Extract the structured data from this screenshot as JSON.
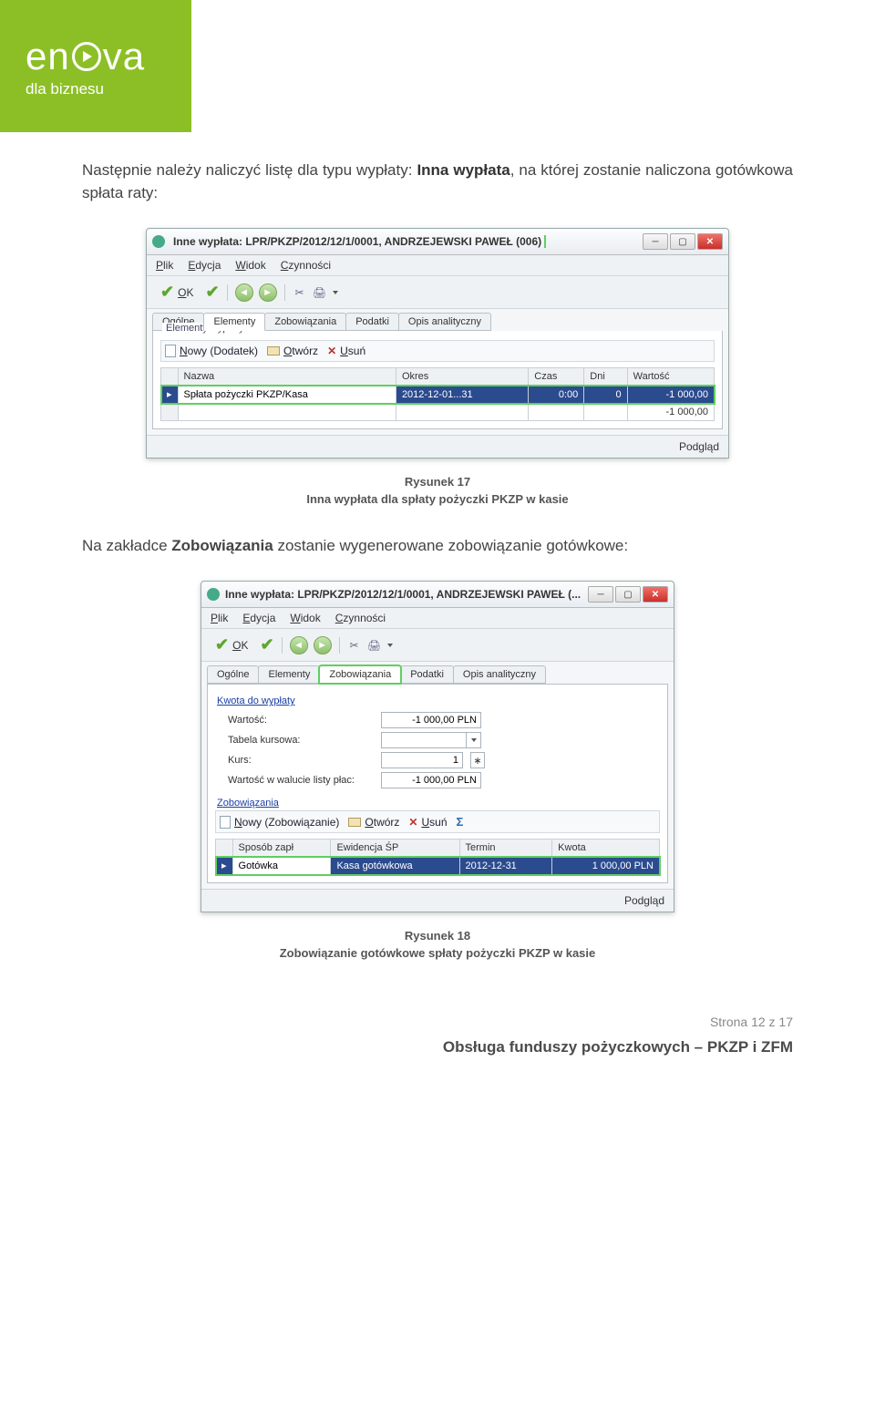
{
  "logo": {
    "brand_pre": "en",
    "brand_post": "va",
    "sub": "dla biznesu"
  },
  "para1_pre": "Następnie należy naliczyć listę dla typu wypłaty: ",
  "para1_bold": "Inna wypłata",
  "para1_post": ", na której zostanie naliczona gotówkowa spłata raty:",
  "win1": {
    "title": "Inne wypłata: LPR/PKZP/2012/12/1/0001, ANDRZEJEWSKI PAWEŁ (006)",
    "menu": {
      "plik_u": "P",
      "plik": "lik",
      "ed_u": "E",
      "ed": "dycja",
      "wid_u": "W",
      "wid": "idok",
      "czyn_u": "C",
      "czyn": "zynności"
    },
    "ok_u": "O",
    "ok": "K",
    "tabs": [
      "Ogólne",
      "Elementy",
      "Zobowiązania",
      "Podatki",
      "Opis analityczny"
    ],
    "legend": "Elementy wypłaty",
    "tb": {
      "nowy_u": "N",
      "nowy": "owy (Dodatek)",
      "otw_u": "O",
      "otw": "twórz",
      "usun_u": "U",
      "usun": "suń"
    },
    "cols": [
      "Nazwa",
      "Okres",
      "Czas",
      "Dni",
      "Wartość"
    ],
    "row": {
      "nazwa": "Spłata pożyczki PKZP/Kasa",
      "okres": "2012-12-01...31",
      "czas": "0:00",
      "dni": "0",
      "wart": "-1 000,00"
    },
    "sum": "-1 000,00",
    "status": "Podgląd"
  },
  "cap1_a": "Rysunek 17",
  "cap1_b": "Inna wypłata dla spłaty pożyczki PKZP w kasie",
  "para2_pre": "Na zakładce ",
  "para2_bold": "Zobowiązania",
  "para2_post": " zostanie wygenerowane zobowiązanie gotówkowe:",
  "win2": {
    "title": "Inne wypłata: LPR/PKZP/2012/12/1/0001, ANDRZEJEWSKI PAWEŁ (...",
    "menu": {
      "plik_u": "P",
      "plik": "lik",
      "ed_u": "E",
      "ed": "dycja",
      "wid_u": "W",
      "wid": "idok",
      "czyn_u": "C",
      "czyn": "zynności"
    },
    "ok_u": "O",
    "ok": "K",
    "tabs": [
      "Ogólne",
      "Elementy",
      "Zobowiązania",
      "Podatki",
      "Opis analityczny"
    ],
    "section1_u": "K",
    "section1": "wota do wypłaty",
    "rows": {
      "wartosc_l": "Wartość:",
      "wartosc_v": "-1 000,00 PLN",
      "tabela_l": "Tabela kursowa:",
      "tabela_v": "",
      "kurs_l": "Kurs:",
      "kurs_v": "1",
      "wwlp_l": "Wartość w walucie listy płac:",
      "wwlp_v": "-1 000,00 PLN"
    },
    "section2_u": "Z",
    "section2": "obowiązania",
    "tb": {
      "nowy_u": "N",
      "nowy": "owy (Zobowiązanie)",
      "otw_u": "O",
      "otw": "twórz",
      "usun_u": "U",
      "usun": "suń"
    },
    "cols": [
      "Sposób zapł",
      "Ewidencja ŚP",
      "Termin",
      "Kwota"
    ],
    "row": {
      "sposob": "Gotówka",
      "ewid": "Kasa gotówkowa",
      "termin": "2012-12-31",
      "kwota": "1 000,00 PLN"
    },
    "status": "Podgląd"
  },
  "cap2_a": "Rysunek 18",
  "cap2_b": "Zobowiązanie gotówkowe spłaty pożyczki PKZP w kasie",
  "footer": {
    "page": "Strona 12 z 17",
    "doc": "Obsługa funduszy pożyczkowych – PKZP i ZFM"
  }
}
